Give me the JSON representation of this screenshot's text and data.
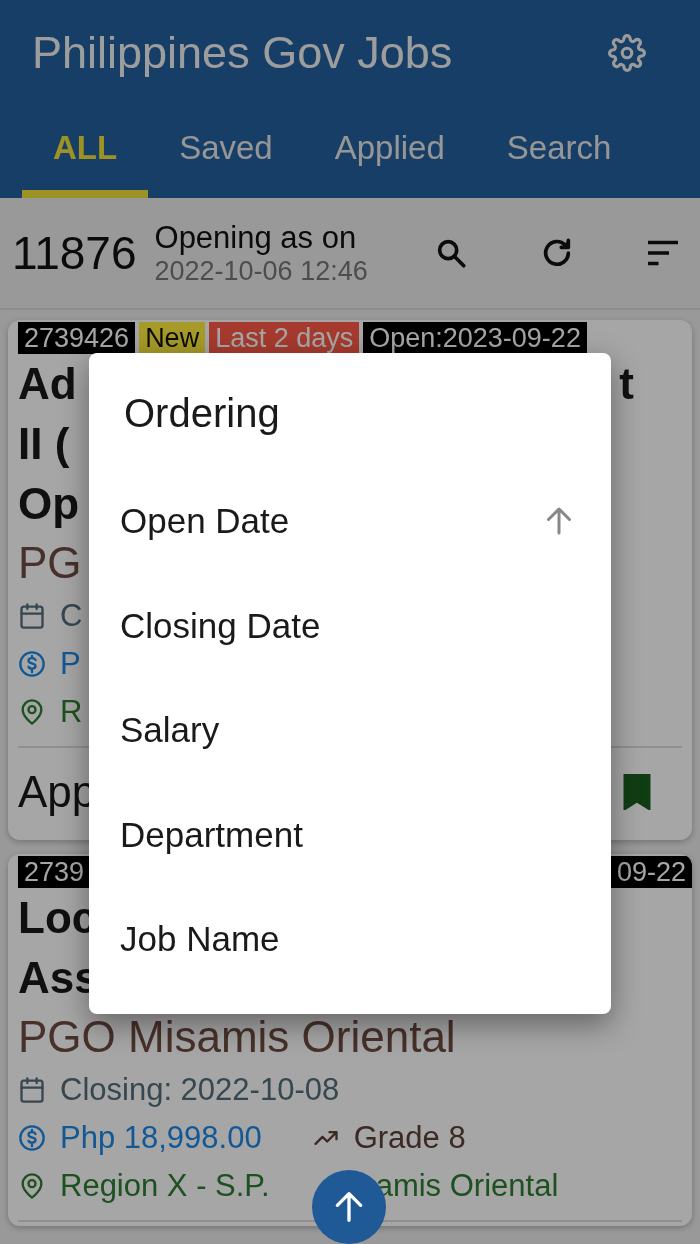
{
  "app_bar": {
    "title": "Philippines Gov Jobs"
  },
  "tabs": [
    {
      "label": "ALL",
      "selected": true
    },
    {
      "label": "Saved",
      "selected": false
    },
    {
      "label": "Applied",
      "selected": false
    },
    {
      "label": "Search",
      "selected": false
    }
  ],
  "summary": {
    "count": "11876",
    "label": "Opening as on",
    "timestamp": "2022-10-06 12:46"
  },
  "cards": [
    {
      "tags": [
        {
          "text": "2739426",
          "color": "#000000"
        },
        {
          "text": "New",
          "color": "#a69a28"
        },
        {
          "text": "Last 2 days",
          "color": "#a63a2e"
        },
        {
          "text": "Open:2023-09-22",
          "color": "#000000"
        }
      ],
      "title_lines": [
        {
          "start": "Ad",
          "end": "t"
        },
        {
          "start": "II ("
        },
        {
          "start": "Op"
        }
      ],
      "department": "PG",
      "closing": "C",
      "salary": "P",
      "region": {
        "start": "R"
      },
      "footer": {
        "action": "App",
        "saved": true
      }
    },
    {
      "tags": [
        {
          "text": "2739",
          "color": "#000000"
        }
      ],
      "tag_end": {
        "text": "09-22",
        "color": "#000000"
      },
      "title_lines": [
        {
          "start": "Loc"
        },
        {
          "start": "Ass"
        }
      ],
      "department": "PGO Misamis Oriental",
      "closing": "Closing: 2022-10-08",
      "salary": "Php 18,998.00",
      "grade": "Grade 8",
      "region": {
        "start": "Region X - S.P.",
        "end": "amis Oriental"
      }
    }
  ],
  "dialog": {
    "title": "Ordering",
    "items": [
      {
        "label": "Open Date",
        "selected": true,
        "ascending": true
      },
      {
        "label": "Closing Date",
        "selected": false
      },
      {
        "label": "Salary",
        "selected": false
      },
      {
        "label": "Department",
        "selected": false
      },
      {
        "label": "Job Name",
        "selected": false
      }
    ]
  }
}
